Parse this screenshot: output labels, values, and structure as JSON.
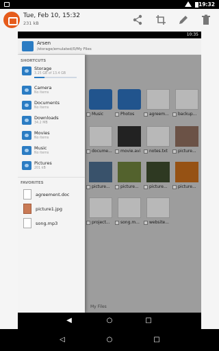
{
  "status_bar": {
    "time": "19:32"
  },
  "app_bar": {
    "title": "Tue, Feb 10, 15:32",
    "subtitle": "231 kB",
    "actions": [
      "share-icon",
      "crop-icon",
      "edit-icon",
      "delete-icon"
    ]
  },
  "inner": {
    "status_time": "10:35",
    "header": {
      "name": "Arsen",
      "path": "/storage/emulated/0/My Files"
    },
    "shortcuts_title": "SHORTCUTS",
    "shortcuts": [
      {
        "name": "Storage",
        "desc": "3.25 GB of 13.4 GB",
        "usage": 0.24
      },
      {
        "name": "Camera",
        "desc": "No items"
      },
      {
        "name": "Documents",
        "desc": "No items"
      },
      {
        "name": "Downloads",
        "desc": "34.2 MB"
      },
      {
        "name": "Movies",
        "desc": "No items"
      },
      {
        "name": "Music",
        "desc": "No items"
      },
      {
        "name": "Pictures",
        "desc": "201 kB"
      }
    ],
    "favorites_title": "FAVORITES",
    "favorites": [
      {
        "name": "agreement.doc"
      },
      {
        "name": "picture1.jpg"
      },
      {
        "name": "song.mp3"
      }
    ],
    "grid_labels": [
      "Music",
      "Photos",
      "agreem...",
      "backup...",
      "docume...",
      "movie.avi",
      "notes.txt",
      "picture...",
      "picture...",
      "picture...",
      "picture...",
      "picture...",
      "project...",
      "song.m...",
      "website..."
    ],
    "breadcrumb": "My Files"
  }
}
